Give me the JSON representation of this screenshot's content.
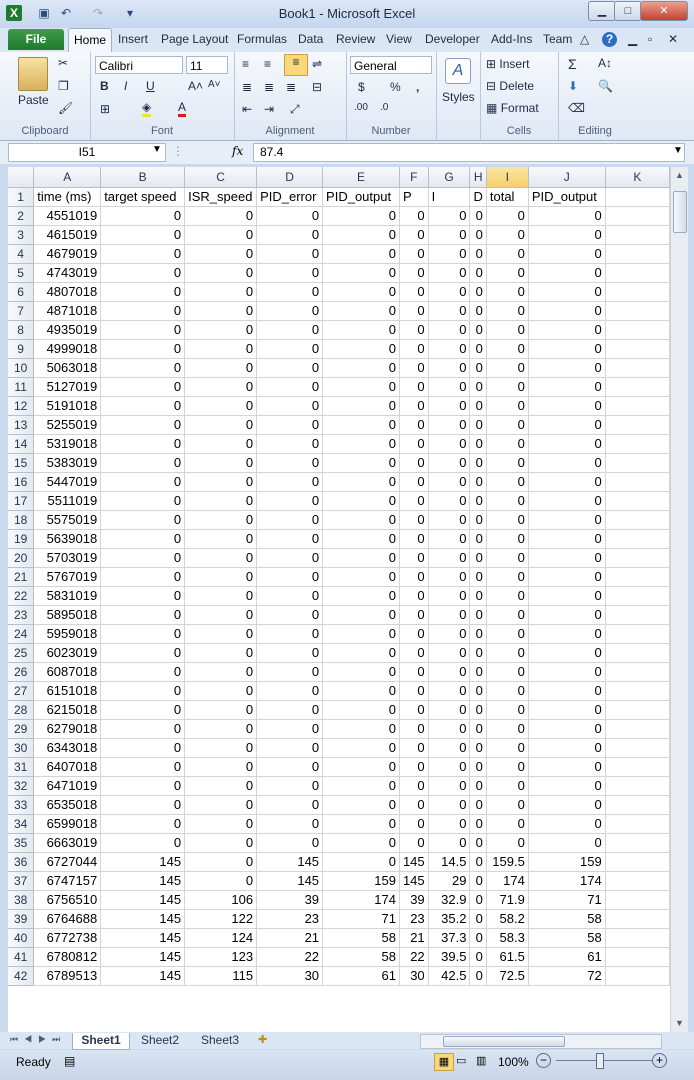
{
  "window": {
    "title": "Book1  -  Microsoft Excel",
    "min_label": "▁",
    "max_label": "□",
    "close_label": "✕"
  },
  "tabs": [
    "File",
    "Home",
    "Insert",
    "Page Layout",
    "Formulas",
    "Data",
    "Review",
    "View",
    "Developer",
    "Add-Ins",
    "Team"
  ],
  "ribbon": {
    "clipboard": {
      "label": "Clipboard",
      "paste": "Paste"
    },
    "font": {
      "label": "Font",
      "name": "Calibri",
      "size": "11",
      "bold": "B",
      "italic": "I",
      "underline": "U"
    },
    "alignment": {
      "label": "Alignment"
    },
    "number": {
      "label": "Number",
      "format": "General",
      "currency": "$",
      "percent": "%",
      "comma": ","
    },
    "styles": {
      "label": "Styles"
    },
    "cells": {
      "label": "Cells",
      "insert": "Insert",
      "delete": "Delete",
      "format": "Format"
    },
    "editing": {
      "label": "Editing"
    }
  },
  "formula_bar": {
    "name_box": "I51",
    "fx": "fx",
    "value": "87.4"
  },
  "columns": [
    "A",
    "B",
    "C",
    "D",
    "E",
    "F",
    "G",
    "H",
    "I",
    "J",
    "K"
  ],
  "selected_column": "I",
  "header_row": [
    "time (ms)",
    "target speed",
    "ISR_speed",
    "PID_error",
    "PID_output",
    "P",
    "I",
    "D",
    "total",
    "PID_output",
    ""
  ],
  "rows": [
    {
      "n": "2",
      "c": [
        "4551019",
        "0",
        "0",
        "0",
        "0",
        "0",
        "0",
        "0",
        "0",
        "0"
      ]
    },
    {
      "n": "3",
      "c": [
        "4615019",
        "0",
        "0",
        "0",
        "0",
        "0",
        "0",
        "0",
        "0",
        "0"
      ]
    },
    {
      "n": "4",
      "c": [
        "4679019",
        "0",
        "0",
        "0",
        "0",
        "0",
        "0",
        "0",
        "0",
        "0"
      ]
    },
    {
      "n": "5",
      "c": [
        "4743019",
        "0",
        "0",
        "0",
        "0",
        "0",
        "0",
        "0",
        "0",
        "0"
      ]
    },
    {
      "n": "6",
      "c": [
        "4807018",
        "0",
        "0",
        "0",
        "0",
        "0",
        "0",
        "0",
        "0",
        "0"
      ]
    },
    {
      "n": "7",
      "c": [
        "4871018",
        "0",
        "0",
        "0",
        "0",
        "0",
        "0",
        "0",
        "0",
        "0"
      ]
    },
    {
      "n": "8",
      "c": [
        "4935019",
        "0",
        "0",
        "0",
        "0",
        "0",
        "0",
        "0",
        "0",
        "0"
      ]
    },
    {
      "n": "9",
      "c": [
        "4999018",
        "0",
        "0",
        "0",
        "0",
        "0",
        "0",
        "0",
        "0",
        "0"
      ]
    },
    {
      "n": "10",
      "c": [
        "5063018",
        "0",
        "0",
        "0",
        "0",
        "0",
        "0",
        "0",
        "0",
        "0"
      ]
    },
    {
      "n": "11",
      "c": [
        "5127019",
        "0",
        "0",
        "0",
        "0",
        "0",
        "0",
        "0",
        "0",
        "0"
      ]
    },
    {
      "n": "12",
      "c": [
        "5191018",
        "0",
        "0",
        "0",
        "0",
        "0",
        "0",
        "0",
        "0",
        "0"
      ]
    },
    {
      "n": "13",
      "c": [
        "5255019",
        "0",
        "0",
        "0",
        "0",
        "0",
        "0",
        "0",
        "0",
        "0"
      ]
    },
    {
      "n": "14",
      "c": [
        "5319018",
        "0",
        "0",
        "0",
        "0",
        "0",
        "0",
        "0",
        "0",
        "0"
      ]
    },
    {
      "n": "15",
      "c": [
        "5383019",
        "0",
        "0",
        "0",
        "0",
        "0",
        "0",
        "0",
        "0",
        "0"
      ]
    },
    {
      "n": "16",
      "c": [
        "5447019",
        "0",
        "0",
        "0",
        "0",
        "0",
        "0",
        "0",
        "0",
        "0"
      ]
    },
    {
      "n": "17",
      "c": [
        "5511019",
        "0",
        "0",
        "0",
        "0",
        "0",
        "0",
        "0",
        "0",
        "0"
      ]
    },
    {
      "n": "18",
      "c": [
        "5575019",
        "0",
        "0",
        "0",
        "0",
        "0",
        "0",
        "0",
        "0",
        "0"
      ]
    },
    {
      "n": "19",
      "c": [
        "5639018",
        "0",
        "0",
        "0",
        "0",
        "0",
        "0",
        "0",
        "0",
        "0"
      ]
    },
    {
      "n": "20",
      "c": [
        "5703019",
        "0",
        "0",
        "0",
        "0",
        "0",
        "0",
        "0",
        "0",
        "0"
      ]
    },
    {
      "n": "21",
      "c": [
        "5767019",
        "0",
        "0",
        "0",
        "0",
        "0",
        "0",
        "0",
        "0",
        "0"
      ]
    },
    {
      "n": "22",
      "c": [
        "5831019",
        "0",
        "0",
        "0",
        "0",
        "0",
        "0",
        "0",
        "0",
        "0"
      ]
    },
    {
      "n": "23",
      "c": [
        "5895018",
        "0",
        "0",
        "0",
        "0",
        "0",
        "0",
        "0",
        "0",
        "0"
      ]
    },
    {
      "n": "24",
      "c": [
        "5959018",
        "0",
        "0",
        "0",
        "0",
        "0",
        "0",
        "0",
        "0",
        "0"
      ]
    },
    {
      "n": "25",
      "c": [
        "6023019",
        "0",
        "0",
        "0",
        "0",
        "0",
        "0",
        "0",
        "0",
        "0"
      ]
    },
    {
      "n": "26",
      "c": [
        "6087018",
        "0",
        "0",
        "0",
        "0",
        "0",
        "0",
        "0",
        "0",
        "0"
      ]
    },
    {
      "n": "27",
      "c": [
        "6151018",
        "0",
        "0",
        "0",
        "0",
        "0",
        "0",
        "0",
        "0",
        "0"
      ]
    },
    {
      "n": "28",
      "c": [
        "6215018",
        "0",
        "0",
        "0",
        "0",
        "0",
        "0",
        "0",
        "0",
        "0"
      ]
    },
    {
      "n": "29",
      "c": [
        "6279018",
        "0",
        "0",
        "0",
        "0",
        "0",
        "0",
        "0",
        "0",
        "0"
      ]
    },
    {
      "n": "30",
      "c": [
        "6343018",
        "0",
        "0",
        "0",
        "0",
        "0",
        "0",
        "0",
        "0",
        "0"
      ]
    },
    {
      "n": "31",
      "c": [
        "6407018",
        "0",
        "0",
        "0",
        "0",
        "0",
        "0",
        "0",
        "0",
        "0"
      ]
    },
    {
      "n": "32",
      "c": [
        "6471019",
        "0",
        "0",
        "0",
        "0",
        "0",
        "0",
        "0",
        "0",
        "0"
      ]
    },
    {
      "n": "33",
      "c": [
        "6535018",
        "0",
        "0",
        "0",
        "0",
        "0",
        "0",
        "0",
        "0",
        "0"
      ]
    },
    {
      "n": "34",
      "c": [
        "6599018",
        "0",
        "0",
        "0",
        "0",
        "0",
        "0",
        "0",
        "0",
        "0"
      ]
    },
    {
      "n": "35",
      "c": [
        "6663019",
        "0",
        "0",
        "0",
        "0",
        "0",
        "0",
        "0",
        "0",
        "0"
      ]
    },
    {
      "n": "36",
      "c": [
        "6727044",
        "145",
        "0",
        "145",
        "0",
        "145",
        "14.5",
        "0",
        "159.5",
        "159"
      ]
    },
    {
      "n": "37",
      "c": [
        "6747157",
        "145",
        "0",
        "145",
        "159",
        "145",
        "29",
        "0",
        "174",
        "174"
      ]
    },
    {
      "n": "38",
      "c": [
        "6756510",
        "145",
        "106",
        "39",
        "174",
        "39",
        "32.9",
        "0",
        "71.9",
        "71"
      ]
    },
    {
      "n": "39",
      "c": [
        "6764688",
        "145",
        "122",
        "23",
        "71",
        "23",
        "35.2",
        "0",
        "58.2",
        "58"
      ]
    },
    {
      "n": "40",
      "c": [
        "6772738",
        "145",
        "124",
        "21",
        "58",
        "21",
        "37.3",
        "0",
        "58.3",
        "58"
      ]
    },
    {
      "n": "41",
      "c": [
        "6780812",
        "145",
        "123",
        "22",
        "58",
        "22",
        "39.5",
        "0",
        "61.5",
        "61"
      ]
    },
    {
      "n": "42",
      "c": [
        "6789513",
        "145",
        "115",
        "30",
        "61",
        "30",
        "42.5",
        "0",
        "72.5",
        "72"
      ]
    }
  ],
  "sheets": [
    "Sheet1",
    "Sheet2",
    "Sheet3"
  ],
  "active_sheet": "Sheet1",
  "status": {
    "ready": "Ready",
    "zoom": "100%"
  }
}
